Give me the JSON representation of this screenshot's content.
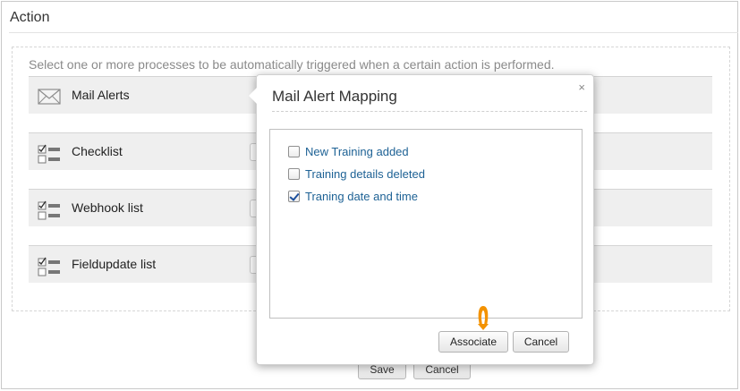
{
  "section": {
    "title": "Action"
  },
  "intro": "Select one or more processes to be automatically triggered when a certain action is performed.",
  "rows": [
    {
      "label": "Mail Alerts",
      "icon": "envelope-icon"
    },
    {
      "label": "Checklist",
      "icon": "checklist-icon"
    },
    {
      "label": "Webhook list",
      "icon": "checklist-icon"
    },
    {
      "label": "Fieldupdate list",
      "icon": "checklist-icon"
    }
  ],
  "footer": {
    "save_label": "Save",
    "cancel_label": "Cancel"
  },
  "modal": {
    "title": "Mail Alert Mapping",
    "close_glyph": "×",
    "options": [
      {
        "label": "New Training added",
        "checked": false
      },
      {
        "label": "Training details deleted",
        "checked": false
      },
      {
        "label": "Traning date and time",
        "checked": true
      }
    ],
    "associate_label": "Associate",
    "cancel_label": "Cancel"
  },
  "colors": {
    "link": "#1e6295",
    "cursor": "#f39200",
    "row_bg": "#efefef"
  }
}
